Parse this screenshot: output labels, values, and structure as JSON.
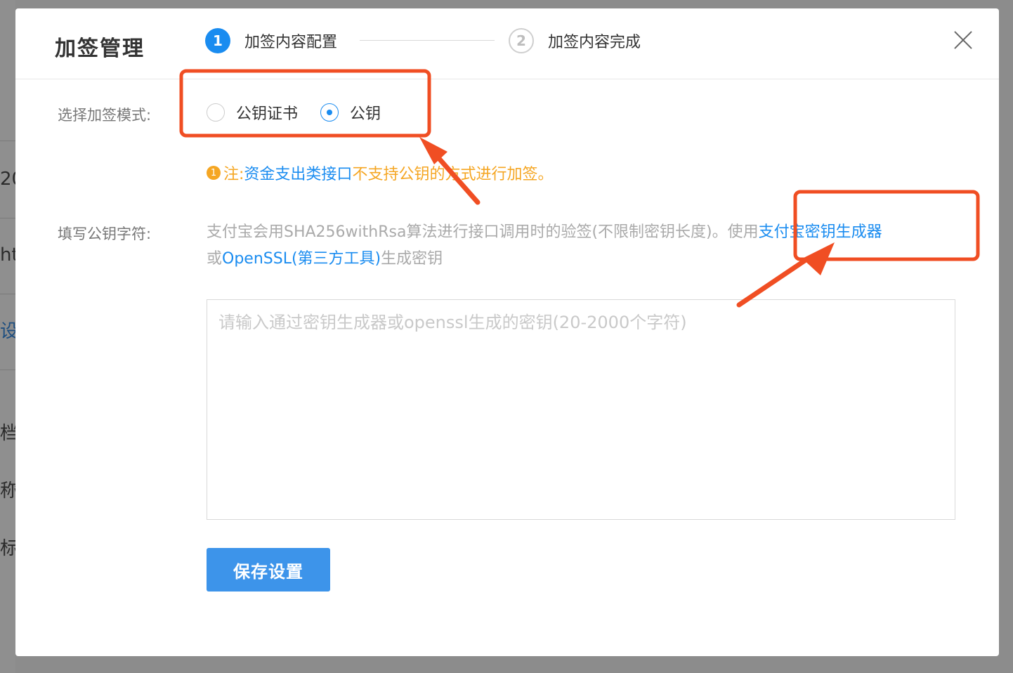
{
  "background": {
    "fragments": [
      "20",
      "ht",
      "设",
      "档",
      "称",
      "标"
    ]
  },
  "dialog": {
    "title": "加签管理",
    "steps": [
      {
        "number": "1",
        "label": "加签内容配置",
        "state": "active"
      },
      {
        "number": "2",
        "label": "加签内容完成",
        "state": "pending"
      }
    ],
    "close_icon": "close-icon"
  },
  "form": {
    "mode_label": "选择加签模式:",
    "mode_options": [
      {
        "label": "公钥证书",
        "selected": false
      },
      {
        "label": "公钥",
        "selected": true
      }
    ],
    "note": {
      "icon_text": "1",
      "prefix": "注:",
      "link": "资金支出类接口",
      "text": "不支持公钥的方式进行加签。"
    },
    "key_label": "填写公钥字符:",
    "description": {
      "text1": "支付宝会用SHA256withRsa算法进行接口调用时的验签(不限制密钥长度)。使用",
      "link1": "支付宝密钥生成器",
      "text2": "或",
      "link2": "OpenSSL(第三方工具)",
      "text3": "生成密钥"
    },
    "textarea_placeholder": "请输入通过密钥生成器或openssl生成的密钥(20-2000个字符)",
    "textarea_value": "",
    "save_button": "保存设置"
  },
  "colors": {
    "primary": "#1a8cf0",
    "button": "#3d94ea",
    "warning": "#f5a623",
    "annotation": "#f04e23"
  }
}
